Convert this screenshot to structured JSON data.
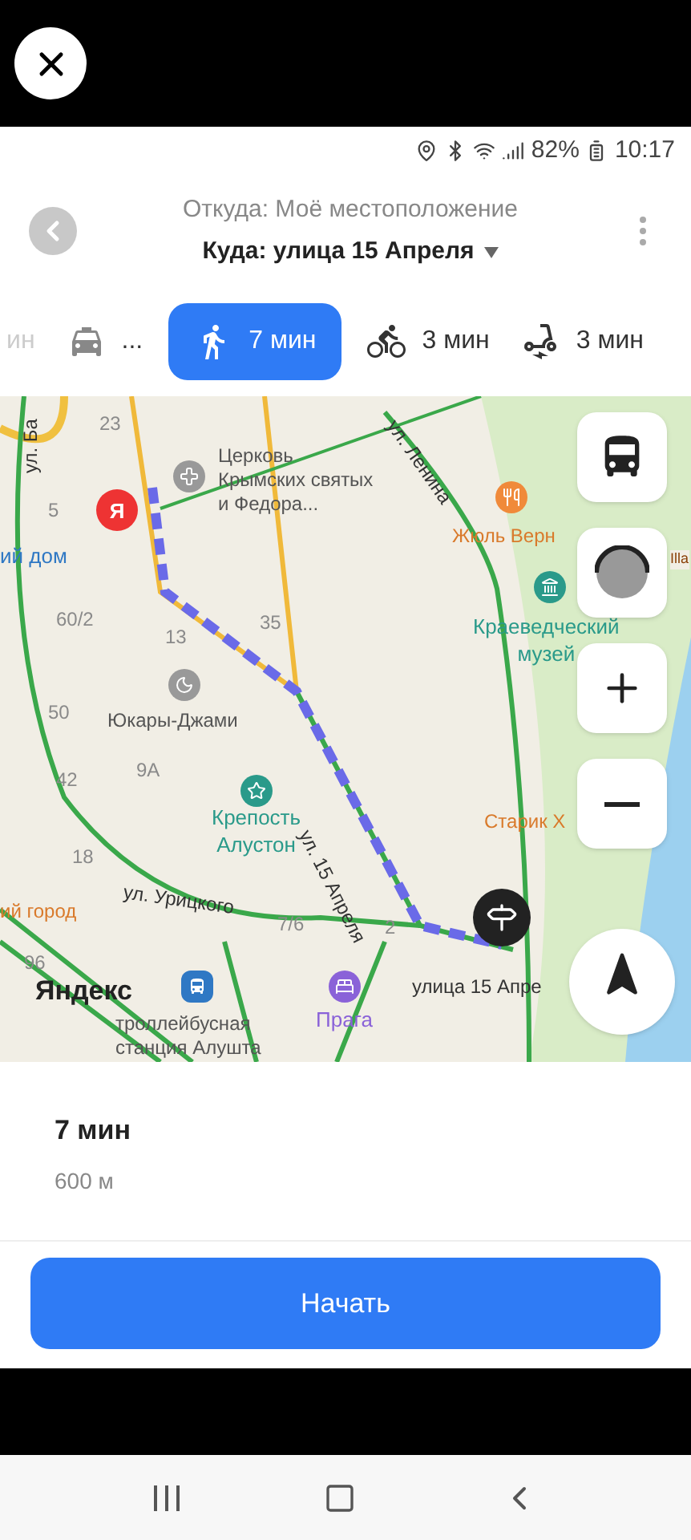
{
  "status_bar": {
    "battery": "82%",
    "time": "10:17"
  },
  "header": {
    "from": "Откуда: Моё местоположение",
    "to": "Куда: улица 15 Апреля"
  },
  "transport_tabs": [
    {
      "kind": "partial",
      "label": "ин",
      "selected": false
    },
    {
      "kind": "taxi",
      "label": "...",
      "selected": false
    },
    {
      "kind": "walk",
      "label": "7 мин",
      "selected": true
    },
    {
      "kind": "bike",
      "label": "3 мин",
      "selected": false
    },
    {
      "kind": "scooter",
      "label": "3 мин",
      "selected": false
    }
  ],
  "map": {
    "labels": [
      {
        "kind": "street",
        "text": "ул. Ба"
      },
      {
        "kind": "number",
        "text": "23"
      },
      {
        "kind": "street",
        "text": "ул. Ленина"
      },
      {
        "kind": "number",
        "text": "5"
      },
      {
        "kind": "poi",
        "text": "Церковь\nКрымских святых\nи Федора..."
      },
      {
        "kind": "food",
        "text": "Жюль Верн"
      },
      {
        "kind": "transit",
        "text": "ий дом"
      },
      {
        "kind": "food",
        "text": "Illa"
      },
      {
        "kind": "number",
        "text": "60/2"
      },
      {
        "kind": "number",
        "text": "35"
      },
      {
        "kind": "number",
        "text": "13"
      },
      {
        "kind": "sight",
        "text": "Краеведческий\nмузей"
      },
      {
        "kind": "number",
        "text": "50"
      },
      {
        "kind": "poi",
        "text": "Юкары-Джами"
      },
      {
        "kind": "number",
        "text": "9А"
      },
      {
        "kind": "number",
        "text": "42"
      },
      {
        "kind": "sight",
        "text": "Крепость\nАлустон"
      },
      {
        "kind": "food",
        "text": "Старик Х"
      },
      {
        "kind": "street",
        "text": "ул. 15 Апреля"
      },
      {
        "kind": "number",
        "text": "18"
      },
      {
        "kind": "street",
        "text": "ул. Урицкого"
      },
      {
        "kind": "food",
        "text": "ий город"
      },
      {
        "kind": "number",
        "text": "7/6"
      },
      {
        "kind": "number",
        "text": "2"
      },
      {
        "kind": "number",
        "text": "96"
      },
      {
        "kind": "logo",
        "text": "Яндекс"
      },
      {
        "kind": "street",
        "text": "улица 15 Апре"
      },
      {
        "kind": "poi",
        "text": "троллейбусная\nстанция Алушта"
      },
      {
        "kind": "hotel",
        "text": "Прага"
      }
    ],
    "yandex_badge": "Я"
  },
  "route": {
    "time": "7 мин",
    "distance": "600 м"
  },
  "start_button": {
    "label": "Начать"
  }
}
